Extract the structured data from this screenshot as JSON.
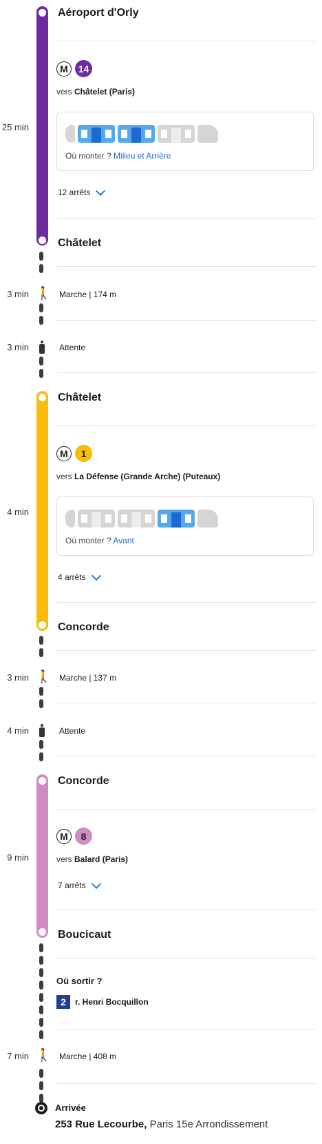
{
  "colors": {
    "line14": "#6e2c9e",
    "line1": "#f9bd09",
    "line8": "#d28ac4",
    "accent": "#1f6ad0"
  },
  "segments": [
    {
      "duration": "25 min",
      "from": "Aéroport d'Orly",
      "metro_label": "M",
      "line": "14",
      "direction_prefix": "vers",
      "direction": "Châtelet (Paris)",
      "board_label": "Où monter ?",
      "board_value": "Milieu et Arrière",
      "stops": "12 arrêts",
      "to": "Châtelet"
    },
    {
      "walk_duration": "3 min",
      "walk_text": "Marche | 174 m",
      "wait_duration": "3 min",
      "wait_text": "Attente"
    },
    {
      "duration": "4 min",
      "from": "Châtelet",
      "metro_label": "M",
      "line": "1",
      "direction_prefix": "vers",
      "direction": "La Défense (Grande Arche) (Puteaux)",
      "board_label": "Où monter ?",
      "board_value": "Avant",
      "stops": "4 arrêts",
      "to": "Concorde"
    },
    {
      "walk_duration": "3 min",
      "walk_text": "Marche | 137 m",
      "wait_duration": "4 min",
      "wait_text": "Attente"
    },
    {
      "duration": "9 min",
      "from": "Concorde",
      "metro_label": "M",
      "line": "8",
      "direction_prefix": "vers",
      "direction": "Balard (Paris)",
      "stops": "7 arrêts",
      "to": "Boucicaut"
    }
  ],
  "exit": {
    "label": "Où sortir ?",
    "number": "2",
    "street": "r. Henri Bocquillon"
  },
  "final_walk": {
    "duration": "7 min",
    "text": "Marche | 408 m"
  },
  "arrival": {
    "label": "Arrivée",
    "street": "253 Rue Lecourbe,",
    "city": "Paris 15e Arrondissement"
  }
}
